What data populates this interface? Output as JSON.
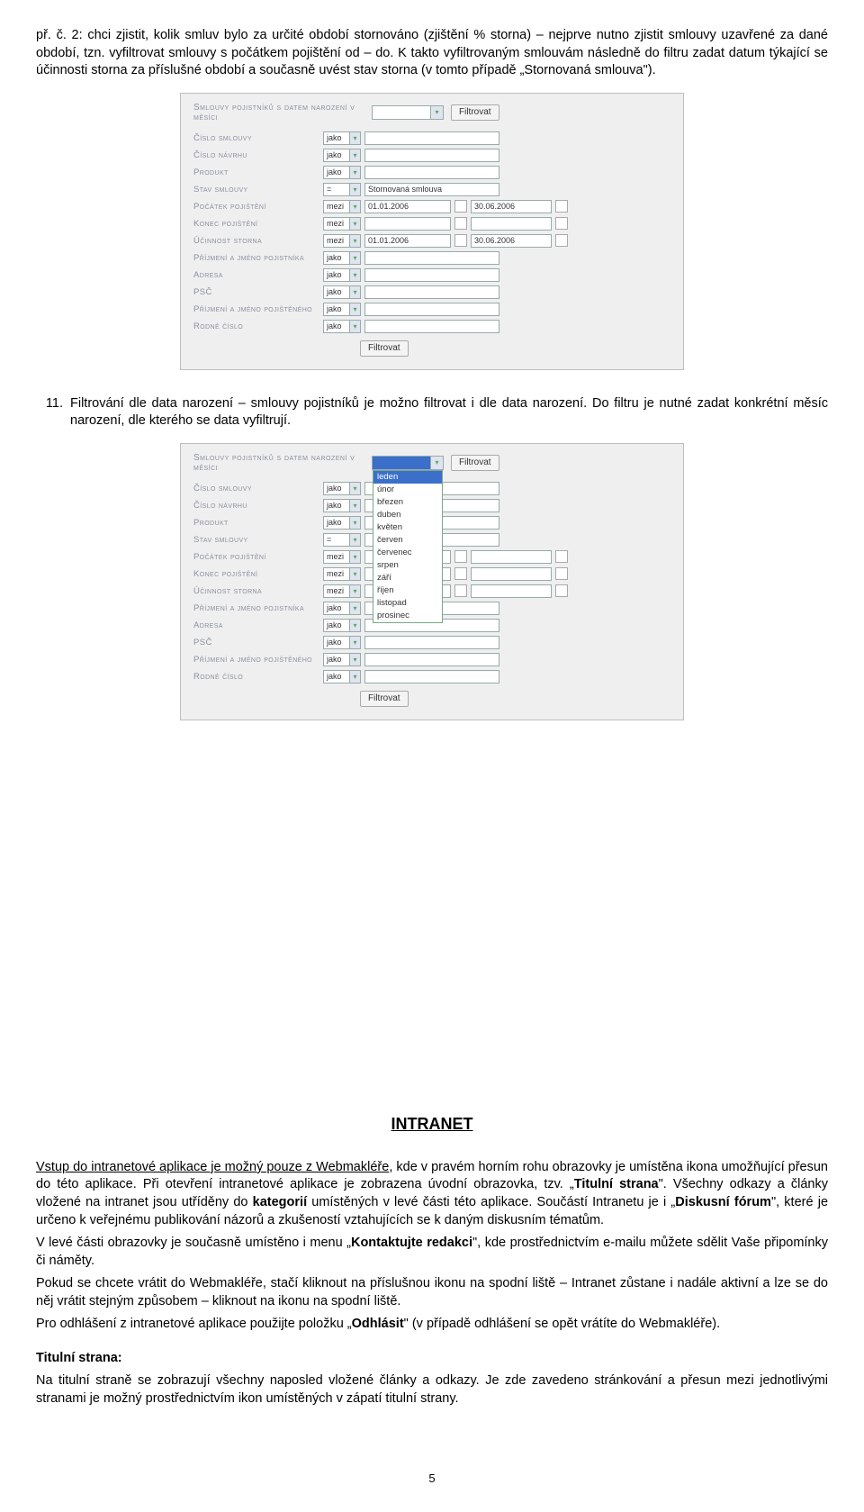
{
  "intro": {
    "p1_part1": "př. č. 2: chci zjistit, kolik smluv bylo za určité období stornováno (zjištění % storna) – nejprve nutno zjistit smlouvy uzavřené za dané období, tzn. vyfiltrovat smlouvy s počátkem pojištění od – do. K takto vyfiltrovaným smlouvám následně do filtru zadat datum týkající se účinnosti storna za příslušné období a současně uvést stav storna (v tomto případě „Stornovaná smlouva\")."
  },
  "filter1": {
    "top_label": "Smlouvy pojistníků s datem narození v měsíci",
    "btn": "Filtrovat",
    "rows": [
      {
        "label": "Číslo smlouvy",
        "op": "jako"
      },
      {
        "label": "Číslo návrhu",
        "op": "jako"
      },
      {
        "label": "Produkt",
        "op": "jako"
      },
      {
        "label": "Stav smlouvy",
        "op": "=",
        "val1": "Stornovaná smlouva"
      },
      {
        "label": "Počátek pojištění",
        "op": "mezi",
        "val1": "01.01.2006",
        "val2": "30.06.2006",
        "date": true
      },
      {
        "label": "Konec pojištění",
        "op": "mezi",
        "date": true
      },
      {
        "label": "Účinnost storna",
        "op": "mezi",
        "val1": "01.01.2006",
        "val2": "30.06.2006",
        "date": true
      },
      {
        "label": "Příjmení a jméno pojistníka",
        "op": "jako"
      },
      {
        "label": "Adresa",
        "op": "jako"
      },
      {
        "label": "PSČ",
        "op": "jako"
      },
      {
        "label": "Příjmení a jméno pojištěného",
        "op": "jako"
      },
      {
        "label": "Rodné číslo",
        "op": "jako"
      }
    ]
  },
  "item11_text": "Filtrování dle data narození – smlouvy pojistníků je možno filtrovat i dle data narození. Do filtru je nutné zadat konkrétní měsíc narození, dle kterého se data vyfiltrují.",
  "filter2": {
    "top_label": "Smlouvy pojistníků s datem narození v měsíci",
    "btn": "Filtrovat",
    "months": [
      "leden",
      "únor",
      "březen",
      "duben",
      "květen",
      "červen",
      "červenec",
      "srpen",
      "září",
      "říjen",
      "listopad",
      "prosinec"
    ],
    "rows": [
      {
        "label": "Číslo smlouvy",
        "op": "jako"
      },
      {
        "label": "Číslo návrhu",
        "op": "jako"
      },
      {
        "label": "Produkt",
        "op": "jako"
      },
      {
        "label": "Stav smlouvy",
        "op": "="
      },
      {
        "label": "Počátek pojištění",
        "op": "mezi",
        "date": true
      },
      {
        "label": "Konec pojištění",
        "op": "mezi",
        "date": true
      },
      {
        "label": "Účinnost storna",
        "op": "mezi",
        "date": true
      },
      {
        "label": "Příjmení a jméno pojistníka",
        "op": "jako"
      },
      {
        "label": "Adresa",
        "op": "jako"
      },
      {
        "label": "PSČ",
        "op": "jako"
      },
      {
        "label": "Příjmení a jméno pojištěného",
        "op": "jako"
      },
      {
        "label": "Rodné číslo",
        "op": "jako"
      }
    ]
  },
  "intranet": {
    "heading": "INTRANET",
    "p1a": "Vstup do intranetové aplikace je možný pouze z Webmakléře",
    "p1b": ", kde v pravém horním rohu obrazovky je umístěna ikona umožňující přesun do této aplikace. Při otevření intranetové aplikace je zobrazena úvodní obrazovka, tzv. „",
    "p1c": "Titulní strana",
    "p1d": "\". Všechny odkazy a články vložené na intranet jsou utříděny do ",
    "p1e": "kategorií",
    "p1f": " umístěných v levé části této aplikace. Součástí Intranetu je i „",
    "p1g": "Diskusní fórum",
    "p1h": "\", které je určeno k veřejnému publikování názorů a zkušeností vztahujících se k daným diskusním tématům.",
    "p2a": "V levé části obrazovky je současně umístěno i menu „",
    "p2b": "Kontaktujte redakci",
    "p2c": "\", kde prostřednictvím e-mailu můžete sdělit Vaše připomínky či náměty.",
    "p3": "Pokud se chcete vrátit do Webmakléře, stačí kliknout na příslušnou ikonu na spodní liště – Intranet zůstane i nadále aktivní a lze se do něj vrátit stejným způsobem – kliknout na ikonu na spodní liště.",
    "p4a": "Pro odhlášení z intranetové aplikace použijte položku „",
    "p4b": "Odhlásit",
    "p4c": "\" (v případě odhlášení se opět vrátíte do Webmakléře).",
    "t_heading": "Titulní strana:",
    "t_body": "Na titulní straně se zobrazují všechny naposled vložené články a odkazy. Je zde zavedeno stránkování a přesun mezi jednotlivými stranami je možný prostřednictvím ikon umístěných v zápatí titulní strany."
  },
  "page_number": "5"
}
